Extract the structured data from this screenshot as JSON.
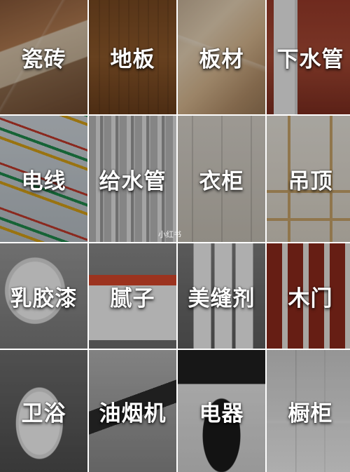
{
  "watermark": "小红书",
  "tiles": [
    {
      "name": "tile-ceramic-tile",
      "label": "瓷砖",
      "bg": "bg-tile-ceramic"
    },
    {
      "name": "tile-floor",
      "label": "地板",
      "bg": "bg-floor"
    },
    {
      "name": "tile-board",
      "label": "板材",
      "bg": "bg-board"
    },
    {
      "name": "tile-drain-pipe",
      "label": "下水管",
      "bg": "bg-pipe-drain"
    },
    {
      "name": "tile-wire",
      "label": "电线",
      "bg": "bg-wire"
    },
    {
      "name": "tile-water-pipe",
      "label": "给水管",
      "bg": "bg-water-pipe"
    },
    {
      "name": "tile-wardrobe",
      "label": "衣柜",
      "bg": "bg-wardrobe"
    },
    {
      "name": "tile-ceiling",
      "label": "吊顶",
      "bg": "bg-ceiling"
    },
    {
      "name": "tile-latex-paint",
      "label": "乳胶漆",
      "bg": "bg-paint"
    },
    {
      "name": "tile-putty",
      "label": "腻子",
      "bg": "bg-putty"
    },
    {
      "name": "tile-sealant",
      "label": "美缝剂",
      "bg": "bg-sealant"
    },
    {
      "name": "tile-wood-door",
      "label": "木门",
      "bg": "bg-doors"
    },
    {
      "name": "tile-bathroom",
      "label": "卫浴",
      "bg": "bg-toilet"
    },
    {
      "name": "tile-range-hood",
      "label": "油烟机",
      "bg": "bg-hood"
    },
    {
      "name": "tile-appliances",
      "label": "电器",
      "bg": "bg-coffee"
    },
    {
      "name": "tile-cabinet",
      "label": "橱柜",
      "bg": "bg-cabinet"
    }
  ]
}
